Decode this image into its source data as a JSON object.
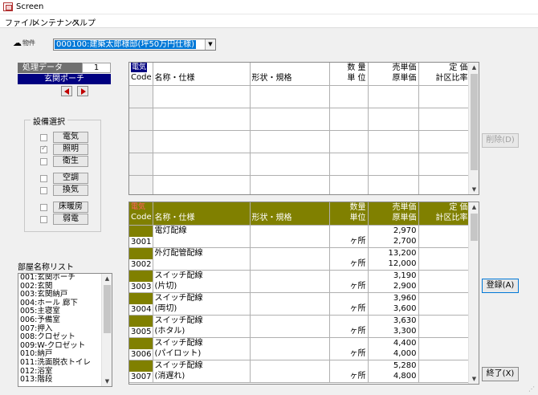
{
  "window": {
    "title": "Screen"
  },
  "menu": [
    "ファイル",
    "メンテナンス",
    "ヘルプ"
  ],
  "property": {
    "label": "物件",
    "selected": "000100:建築太郎様邸(坪50万円仕様)"
  },
  "processing": {
    "label": "処理データ",
    "count": "1",
    "room": "玄関ポーチ"
  },
  "equipment": {
    "title": "設備選択",
    "items": [
      {
        "label": "電気",
        "checked": false
      },
      {
        "label": "照明",
        "checked": true
      },
      {
        "label": "衛生",
        "checked": false
      },
      {
        "label": "空調",
        "checked": false
      },
      {
        "label": "換気",
        "checked": false
      },
      {
        "label": "床暖房",
        "checked": false
      },
      {
        "label": "弱電",
        "checked": false
      }
    ]
  },
  "rooms": {
    "title": "部屋名称リスト",
    "items": [
      "001:玄関ポーチ",
      "002:玄関",
      "003:玄関納戸",
      "004:ホール 廊下",
      "005:主寝室",
      "006:予備室",
      "007:押入",
      "008:クロゼット",
      "009:W-クロゼット",
      "010:納戸",
      "011:洗面脱衣トイレ",
      "012:浴室",
      "013:階段"
    ]
  },
  "grid_top": {
    "category": "電気",
    "headers": {
      "code": "Code",
      "name": "名称・仕様",
      "spec": "形状・規格",
      "qty1": "数 量",
      "qty2": "単 位",
      "price1": "売単価",
      "price2": "原単価",
      "rate1": "定 価",
      "rate2": "計区比率"
    }
  },
  "grid_bottom": {
    "category": "電気",
    "headers": {
      "code": "Code",
      "name": "名称・仕様",
      "spec": "形状・規格",
      "qty1": "数量",
      "qty2": "単位",
      "price1": "売単価",
      "price2": "原単価",
      "rate1": "定 価",
      "rate2": "計区比率"
    },
    "rows": [
      {
        "code": "3001",
        "name1": "電灯配線",
        "name2": "",
        "unit": "ヶ所",
        "sell": "2,970",
        "cost": "2,700"
      },
      {
        "code": "3002",
        "name1": "外灯配管配線",
        "name2": "",
        "unit": "ヶ所",
        "sell": "13,200",
        "cost": "12,000"
      },
      {
        "code": "3003",
        "name1": "スイッチ配線",
        "name2": "(片切)",
        "unit": "ヶ所",
        "sell": "3,190",
        "cost": "2,900"
      },
      {
        "code": "3004",
        "name1": "スイッチ配線",
        "name2": "(両切)",
        "unit": "ヶ所",
        "sell": "3,960",
        "cost": "3,600"
      },
      {
        "code": "3005",
        "name1": "スイッチ配線",
        "name2": "(ホタル)",
        "unit": "ヶ所",
        "sell": "3,630",
        "cost": "3,300"
      },
      {
        "code": "3006",
        "name1": "スイッチ配線",
        "name2": "(パイロット)",
        "unit": "ヶ所",
        "sell": "4,400",
        "cost": "4,000"
      },
      {
        "code": "3007",
        "name1": "スイッチ配線",
        "name2": "(消遅れ)",
        "unit": "ヶ所",
        "sell": "5,280",
        "cost": "4,800"
      }
    ]
  },
  "buttons": {
    "delete": "削除(D)",
    "register": "登録(A)",
    "exit": "終了(X)"
  }
}
